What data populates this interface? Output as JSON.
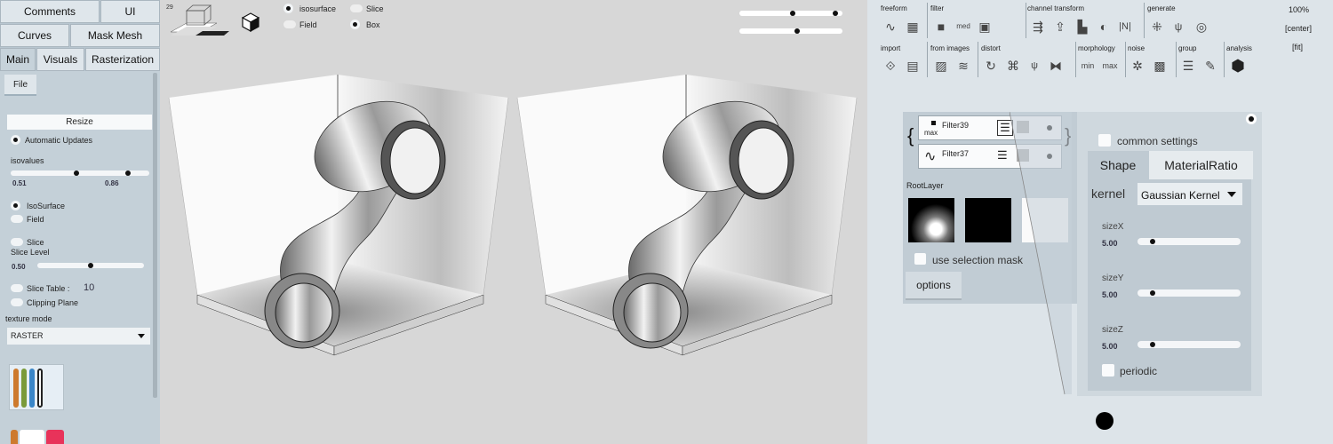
{
  "left_panel": {
    "tabs": [
      "Comments",
      "UI",
      "Curves",
      "Mask Mesh",
      "Main",
      "Visuals",
      "Rasterization"
    ],
    "file_tab": "File",
    "resize_button": "Resize",
    "automatic_updates": "Automatic Updates",
    "isovalues_label": "isovalues",
    "iso_low": "0.51",
    "iso_high": "0.86",
    "isosurface": "IsoSurface",
    "field": "Field",
    "slice": "Slice",
    "slice_level_label": "Slice Level",
    "slice_level_value": "0.50",
    "slice_table": "Slice Table :",
    "slice_table_value": "10",
    "clipping_plane": "Clipping Plane",
    "texture_mode_label": "texture mode",
    "texture_mode_value": "RASTER"
  },
  "viewport": {
    "frame_number": "29",
    "opt_isosurface": "isosurface",
    "opt_slice": "Slice",
    "opt_field": "Field",
    "opt_box": "Box"
  },
  "right_panel": {
    "categories": [
      "freeform",
      "filter",
      "channel transform",
      "generate",
      "import",
      "from images",
      "distort",
      "morphology",
      "noise",
      "group",
      "analysis"
    ],
    "zoom": "100%",
    "center": "[center]",
    "fit": "[fit]",
    "filter_a_name": "Filter39",
    "filter_a_icon_text": "max",
    "filter_b_name": "Filter37",
    "root_layer": "RootLayer",
    "use_selection_mask": "use selection mask",
    "options_button": "options",
    "common_settings": "common settings",
    "tab_shape": "Shape",
    "tab_material": "MaterialRatio",
    "kernel_label": "kernel",
    "kernel_value": "Gaussian Kernel",
    "size_x_label": "sizeX",
    "size_x_value": "5.00",
    "size_y_label": "sizeY",
    "size_y_value": "5.00",
    "size_z_label": "sizeZ",
    "size_z_value": "5.00",
    "periodic": "periodic",
    "morph_min": "min",
    "morph_max": "max",
    "med": "med"
  }
}
